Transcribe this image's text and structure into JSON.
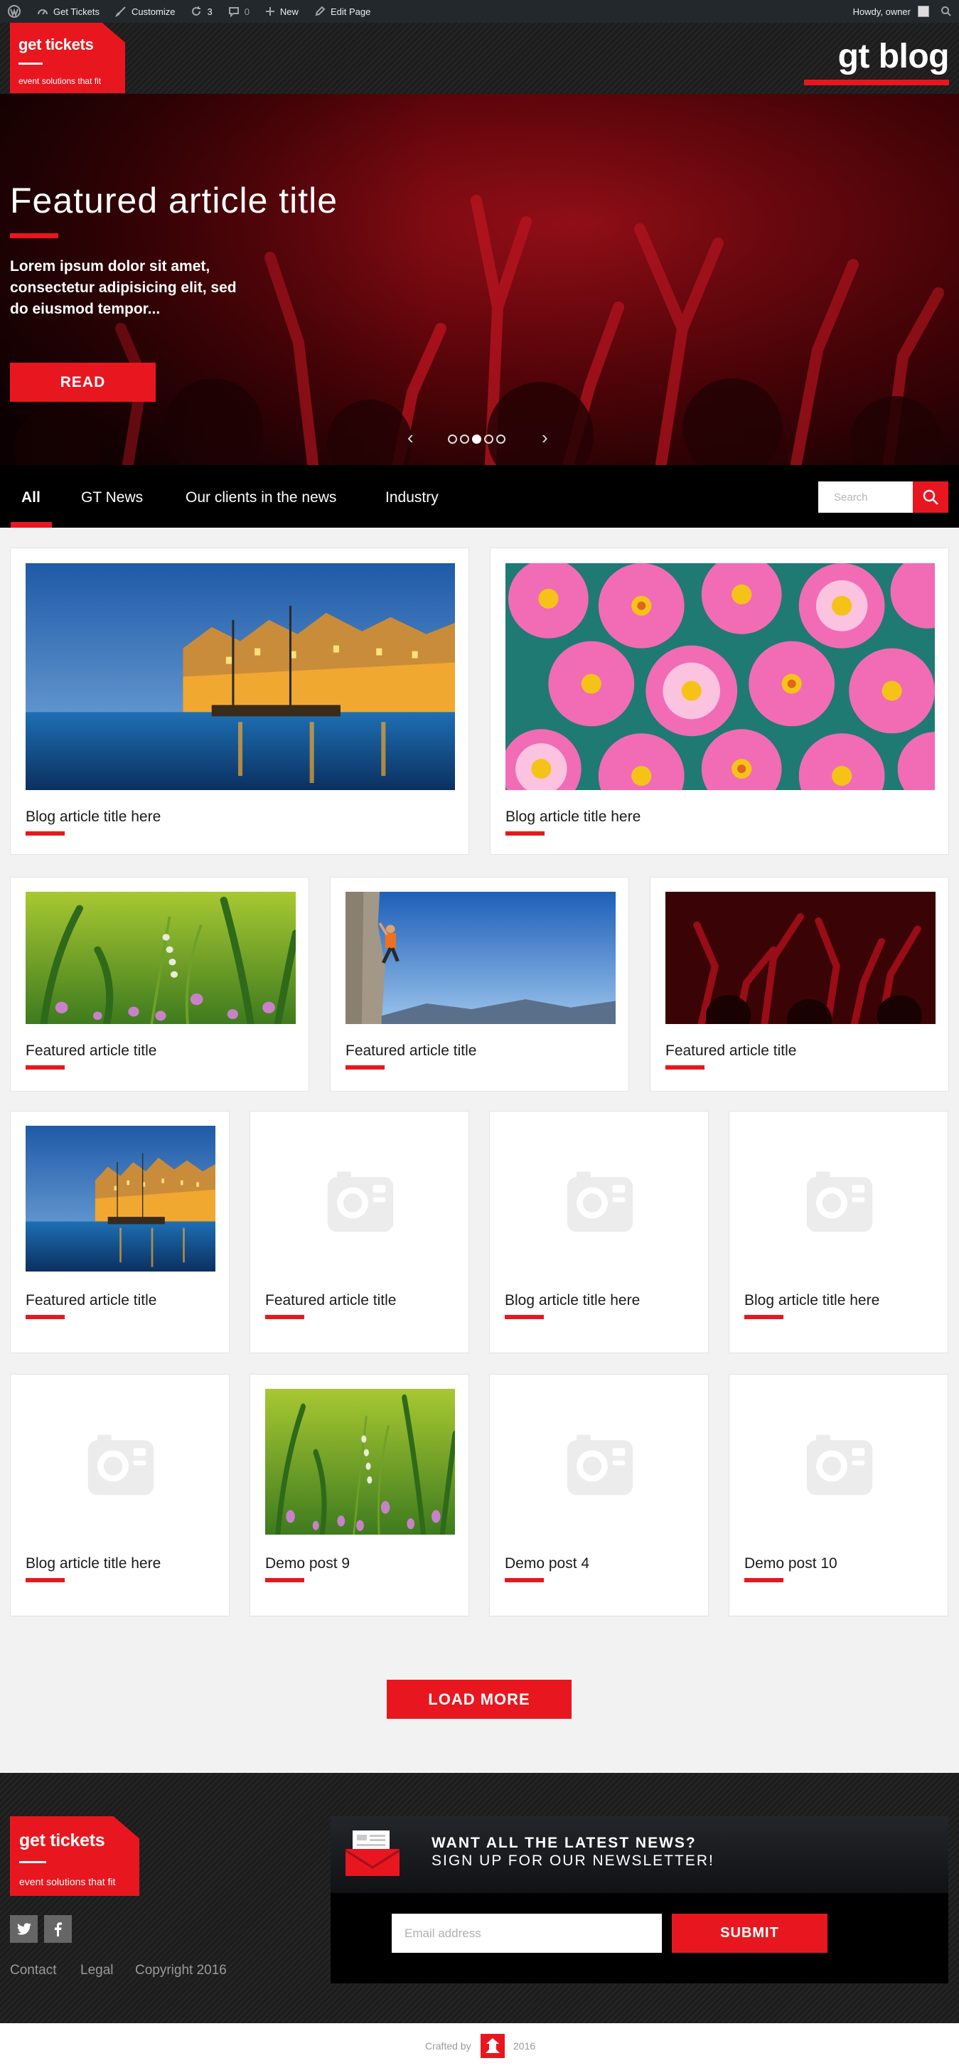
{
  "adminbar": {
    "site_name": "Get Tickets",
    "customize": "Customize",
    "updates": "3",
    "comments": "0",
    "new": "New",
    "edit_page": "Edit Page",
    "howdy": "Howdy, owner"
  },
  "header": {
    "logo_title": "get tickets",
    "logo_tagline": "event solutions that fit",
    "blog_title": "gt blog"
  },
  "hero": {
    "title": "Featured article title",
    "description": "Lorem ipsum dolor sit amet, consectetur adipisicing elit, sed do eiusmod tempor...",
    "read_label": "READ",
    "slide_count": 5,
    "active_slide": 3
  },
  "nav": {
    "items": [
      "All",
      "GT News",
      "Our clients in the news",
      "Industry"
    ],
    "active": "All",
    "search_placeholder": "Search"
  },
  "posts": [
    {
      "title": "Blog article title here",
      "image": "canal"
    },
    {
      "title": "Blog article title here",
      "image": "flowers"
    },
    {
      "title": "Featured article title",
      "image": "grass"
    },
    {
      "title": "Featured article title",
      "image": "climber"
    },
    {
      "title": "Featured article title",
      "image": "crowd"
    },
    {
      "title": "Featured article title",
      "image": "canal"
    },
    {
      "title": "Featured article title",
      "image": "placeholder"
    },
    {
      "title": "Blog article title here",
      "image": "placeholder"
    },
    {
      "title": "Blog article title here",
      "image": "placeholder"
    },
    {
      "title": "Blog article title here",
      "image": "placeholder"
    },
    {
      "title": "Demo post 9",
      "image": "grass"
    },
    {
      "title": "Demo post 4",
      "image": "placeholder"
    },
    {
      "title": "Demo post 10",
      "image": "placeholder"
    }
  ],
  "load_more_label": "LOAD MORE",
  "footer": {
    "logo_title": "get tickets",
    "logo_tagline": "event solutions that fit",
    "links": [
      "Contact",
      "Legal",
      "Copyright 2016"
    ],
    "newsletter_heading": "WANT ALL THE LATEST NEWS?",
    "newsletter_subheading": "SIGN UP FOR OUR NEWSLETTER!",
    "email_placeholder": "Email address",
    "submit_label": "SUBMIT",
    "crafted_by": "Crafted by",
    "crafted_year": "2016"
  },
  "colors": {
    "accent": "#e8171f",
    "dark": "#1f1f1f",
    "admin_bar": "#23282d"
  }
}
